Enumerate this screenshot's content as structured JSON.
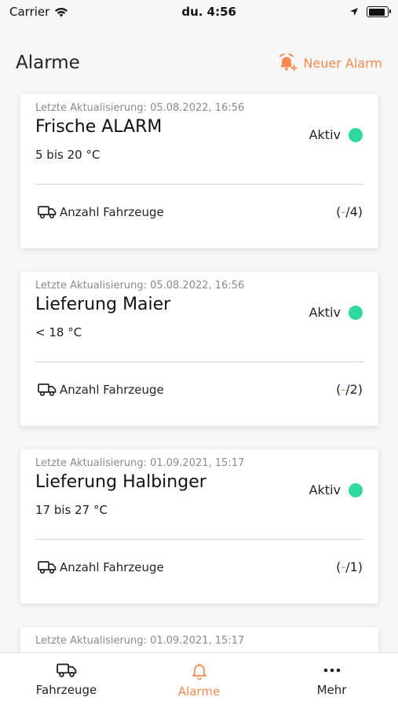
{
  "status_bar": {
    "carrier": "Carrier",
    "time": "du. 4:56"
  },
  "header": {
    "title": "Alarme",
    "new_alarm_label": "Neuer Alarm"
  },
  "colors": {
    "accent": "#f58a4c",
    "active": "#2fd99e"
  },
  "alarms": [
    {
      "updated": "Letzte Aktualisierung: 05.08.2022, 16:56",
      "name": "Frische ALARM",
      "range": "5 bis 20 °C",
      "status": "Aktiv",
      "vehicles_label": "Anzahl Fahrzeuge",
      "count_open": "(",
      "count_dash": "-",
      "count_total": "/4)"
    },
    {
      "updated": "Letzte Aktualisierung: 05.08.2022, 16:56",
      "name": "Lieferung Maier",
      "range": "< 18 °C",
      "status": "Aktiv",
      "vehicles_label": "Anzahl Fahrzeuge",
      "count_open": "(",
      "count_dash": "-",
      "count_total": "/2)"
    },
    {
      "updated": "Letzte Aktualisierung: 01.09.2021, 15:17",
      "name": "Lieferung Halbinger",
      "range": "17 bis 27 °C",
      "status": "Aktiv",
      "vehicles_label": "Anzahl Fahrzeuge",
      "count_open": "(",
      "count_dash": "-",
      "count_total": "/1)"
    },
    {
      "updated": "Letzte Aktualisierung: 01.09.2021, 15:17"
    }
  ],
  "tabs": [
    {
      "label": "Fahrzeuge",
      "icon": "truck-icon"
    },
    {
      "label": "Alarme",
      "icon": "bell-icon",
      "active": true
    },
    {
      "label": "Mehr",
      "icon": "more-dots-icon"
    }
  ]
}
